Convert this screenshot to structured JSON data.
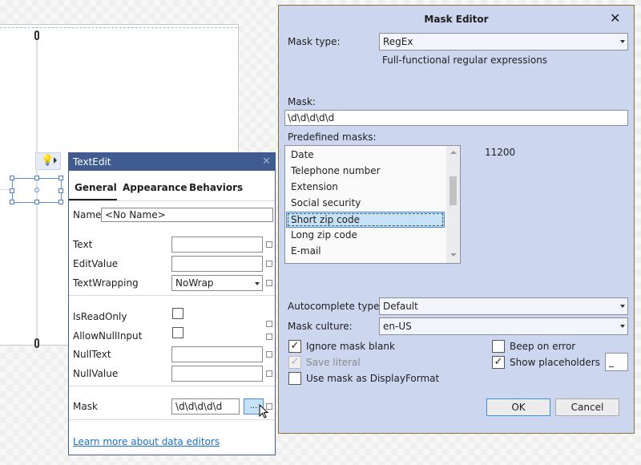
{
  "textedit": {
    "title": "TextEdit",
    "tabs": [
      "General",
      "Appearance",
      "Behaviors"
    ],
    "active_tab": "General",
    "name_label": "Name",
    "name_value": "<No Name>",
    "props": {
      "text": "Text",
      "edit_value": "EditValue",
      "text_wrapping": "TextWrapping",
      "text_wrapping_value": "NoWrap",
      "is_read_only": "IsReadOnly",
      "allow_null_input": "AllowNullInput",
      "null_text": "NullText",
      "null_value": "NullValue",
      "mask": "Mask",
      "mask_value": "\\d\\d\\d\\d\\d",
      "ellipsis": "..."
    },
    "link": "Learn more about data editors"
  },
  "mask_editor": {
    "title": "Mask Editor",
    "mask_type_label": "Mask type:",
    "mask_type_value": "RegEx",
    "mask_type_desc": "Full-functional regular expressions",
    "mask_label": "Mask:",
    "mask_value": "\\d\\d\\d\\d\\d",
    "predefined_label": "Predefined masks:",
    "predefined": [
      "Date",
      "Telephone number",
      "Extension",
      "Social security",
      "Short zip code",
      "Long zip code",
      "E-mail"
    ],
    "selected": "Short zip code",
    "preview": "11200",
    "autocomplete_label": "Autocomplete type:",
    "autocomplete_value": "Default",
    "culture_label": "Mask culture:",
    "culture_value": "en-US",
    "ignore_blank": {
      "label": "Ignore mask blank",
      "checked": true
    },
    "save_literal": {
      "label": "Save literal",
      "checked": true,
      "disabled": true
    },
    "use_display": {
      "label": "Use mask as DisplayFormat",
      "checked": false
    },
    "beep": {
      "label": "Beep on error",
      "checked": false
    },
    "show_placeholders": {
      "label": "Show placeholders",
      "checked": true
    },
    "placeholder_char": "_",
    "ok": "OK",
    "cancel": "Cancel"
  },
  "colors": {
    "popup_header": "#3f5b8f",
    "dialog_bg": "#cdd6ef",
    "selection": "#c6e2f4"
  }
}
